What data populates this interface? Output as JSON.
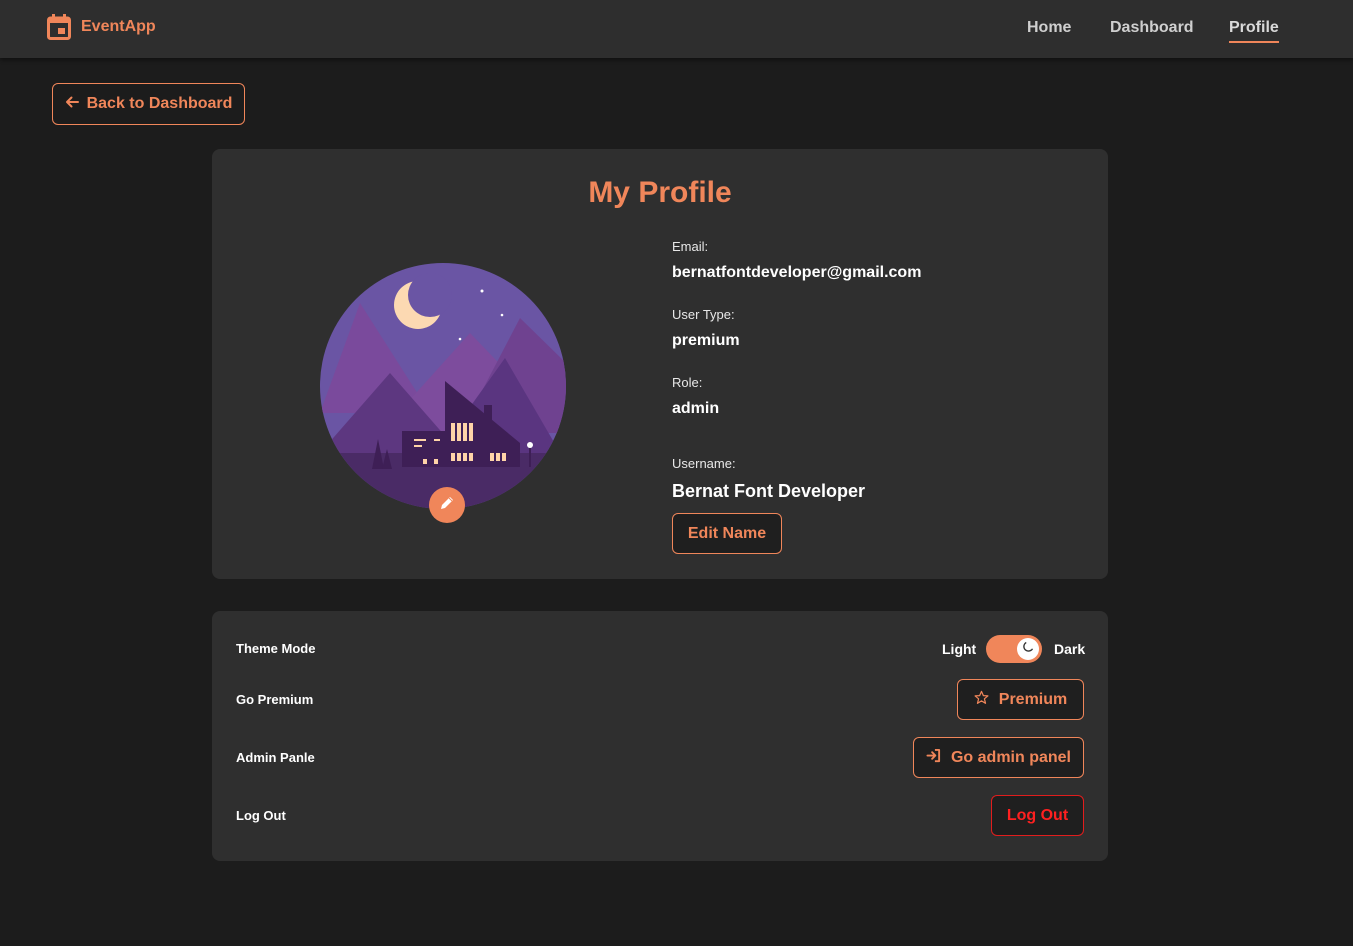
{
  "nav": {
    "brand": "EventApp",
    "links": [
      "Home",
      "Dashboard",
      "Profile"
    ],
    "active": "Profile"
  },
  "back_button": {
    "label": "Back to Dashboard",
    "icon": "arrow-left-icon"
  },
  "profile": {
    "title": "My Profile",
    "email_label": "Email:",
    "email": "bernatfontdeveloper@gmail.com",
    "user_type_label": "User Type:",
    "user_type": "premium",
    "role_label": "Role:",
    "role": "admin",
    "username_label": "Username:",
    "username": "Bernat Font Developer",
    "edit_name_label": "Edit Name"
  },
  "settings": {
    "theme": {
      "label": "Theme Mode",
      "light": "Light",
      "dark": "Dark",
      "mode": "dark"
    },
    "premium": {
      "label": "Go Premium",
      "button": "Premium",
      "icon": "star-icon"
    },
    "admin": {
      "label": "Admin Panle",
      "button": "Go admin panel",
      "icon": "sign-in-icon"
    },
    "logout": {
      "label": "Log Out",
      "button": "Log Out"
    }
  },
  "colors": {
    "accent": "#f0865a",
    "background": "#1c1c1c",
    "card": "#2f2f2f",
    "danger": "#e11d1d"
  }
}
